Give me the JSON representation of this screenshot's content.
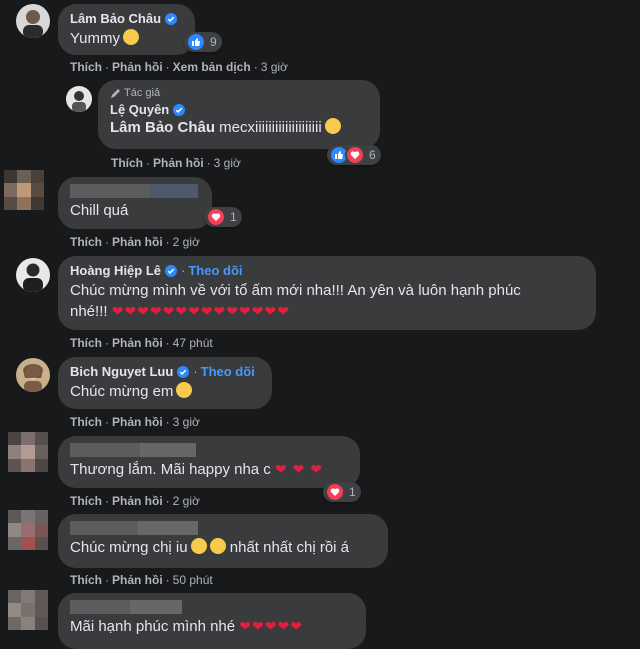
{
  "comments": [
    {
      "author": "Lâm Bảo Châu",
      "text": "Yummy",
      "reaction_count": "9",
      "actions": {
        "like": "Thích",
        "reply": "Phản hồi",
        "translate": "Xem bản dịch",
        "time": "3 giờ"
      }
    },
    {
      "author_tag": "Tác giả",
      "author": "Lệ Quyên",
      "mention": "Lâm Bảo Châu",
      "text": " mecxiiiiiiiiiiiiiiiiiiii",
      "reaction_count": "6",
      "actions": {
        "like": "Thích",
        "reply": "Phản hồi",
        "time": "3 giờ"
      }
    },
    {
      "text": "Chill quá",
      "reaction_count": "1",
      "actions": {
        "like": "Thích",
        "reply": "Phản hồi",
        "time": "2 giờ"
      }
    },
    {
      "author": "Hoàng Hiệp Lê",
      "follow": "Theo dõi",
      "text_line1": "Chúc mừng mình về với tổ ấm mới nha!!! An yên và luôn hạnh phúc",
      "text_line2": "nhé!!! ",
      "hearts": "❤❤❤❤❤❤❤❤❤❤❤❤❤❤",
      "actions": {
        "like": "Thích",
        "reply": "Phản hồi",
        "time": "47 phút"
      }
    },
    {
      "author": "Bich Nguyet Luu",
      "follow": "Theo dõi",
      "text": "Chúc mừng em",
      "actions": {
        "like": "Thích",
        "reply": "Phản hồi",
        "time": "3 giờ"
      }
    },
    {
      "text": "Thương lắm. Mãi happy nha c ",
      "hearts": "❤ ❤ ❤",
      "reaction_count": "1",
      "actions": {
        "like": "Thích",
        "reply": "Phản hồi",
        "time": "2 giờ"
      }
    },
    {
      "text": "Chúc mừng chị iu",
      "text_after": " nhất nhất chị rồi á",
      "actions": {
        "like": "Thích",
        "reply": "Phản hồi",
        "time": "50 phút"
      }
    },
    {
      "text": "Mãi hạnh phúc mình nhé ",
      "hearts": "❤❤❤❤❤",
      "actions": {}
    }
  ],
  "colors": {
    "background": "#18191a",
    "bubble": "#3a3b3c",
    "link": "#4599ff",
    "like": "#2d88ff",
    "love": "#f33e58"
  }
}
